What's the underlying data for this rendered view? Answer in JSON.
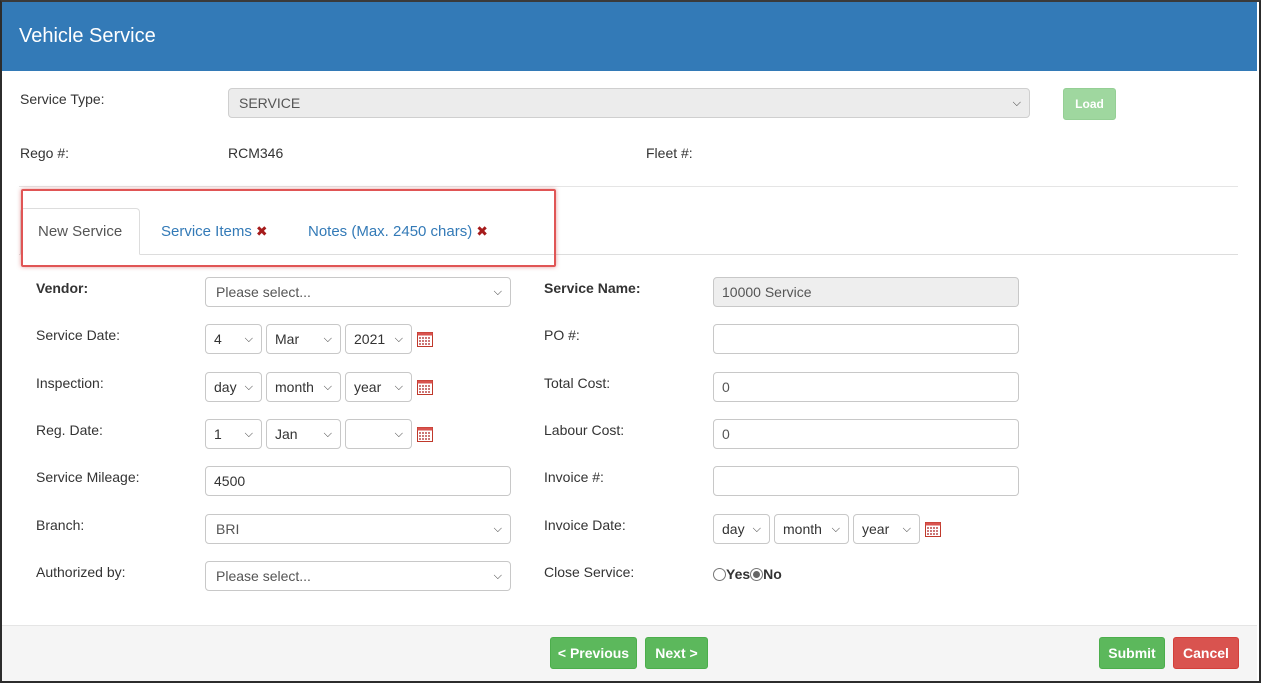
{
  "window": {
    "title": "Vehicle Service"
  },
  "service_type": {
    "label": "Service Type:",
    "value": "SERVICE",
    "load_button": "Load"
  },
  "rego": {
    "label": "Rego #:",
    "value": "RCM346"
  },
  "fleet": {
    "label": "Fleet #:",
    "value": ""
  },
  "tabs": [
    {
      "label": "New Service",
      "active": true,
      "error": false
    },
    {
      "label": "Service Items",
      "active": false,
      "error": true
    },
    {
      "label": "Notes (Max. 2450 chars)",
      "active": false,
      "error": true
    }
  ],
  "tab_error_glyph": "✖",
  "form_left": {
    "vendor": {
      "label": "Vendor:",
      "value": "Please select..."
    },
    "service_date": {
      "label": "Service Date:",
      "day": "4",
      "month": "Mar",
      "year": "2021"
    },
    "inspection": {
      "label": "Inspection:",
      "day": "day",
      "month": "month",
      "year": "year"
    },
    "reg_date": {
      "label": "Reg. Date:",
      "day": "1",
      "month": "Jan",
      "year": ""
    },
    "service_mileage": {
      "label": "Service Mileage:",
      "value": "4500"
    },
    "branch": {
      "label": "Branch:",
      "value": "BRI"
    },
    "authorized_by": {
      "label": "Authorized by:",
      "value": "Please select..."
    }
  },
  "form_right": {
    "service_name": {
      "label": "Service Name:",
      "value": "10000 Service"
    },
    "po": {
      "label": "PO #:",
      "value": ""
    },
    "total_cost": {
      "label": "Total Cost:",
      "value": "0"
    },
    "labour_cost": {
      "label": "Labour Cost:",
      "value": "0"
    },
    "invoice_no": {
      "label": "Invoice #:",
      "value": ""
    },
    "invoice_date": {
      "label": "Invoice Date:",
      "day": "day",
      "month": "month",
      "year": "year"
    },
    "close_service": {
      "label": "Close Service:",
      "yes": "Yes",
      "no": "No",
      "selected": "No"
    }
  },
  "footer": {
    "previous": "< Previous",
    "next": "Next >",
    "submit": "Submit",
    "cancel": "Cancel"
  },
  "colors": {
    "header": "#337ab7",
    "success": "#5cb85c",
    "danger": "#d9534f",
    "highlight": "#e05555"
  },
  "icons": {
    "calendar": "calendar-icon",
    "dropdown": "chevron-down-icon"
  }
}
